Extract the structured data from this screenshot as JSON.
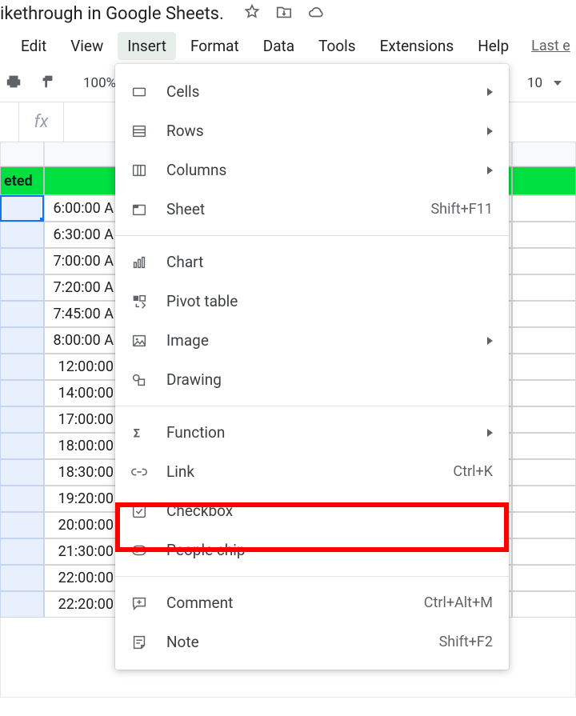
{
  "title": "ikethrough in Google Sheets.",
  "menubar": {
    "edit": "Edit",
    "view": "View",
    "insert": "Insert",
    "format": "Format",
    "data": "Data",
    "tools": "Tools",
    "extensions": "Extensions",
    "help": "Help",
    "last_edit": "Last e"
  },
  "toolbar": {
    "zoom": "100%",
    "fontsize": "10"
  },
  "formula": {
    "fx": "fx"
  },
  "sheet": {
    "header_label": "eted",
    "times": [
      "6:00:00 A",
      "6:30:00 A",
      "7:00:00 A",
      "7:20:00 A",
      "7:45:00 A",
      "8:00:00 A",
      "12:00:00",
      "14:00:00",
      "17:00:00",
      "18:00:00",
      "18:30:00",
      "19:20:00",
      "20:00:00",
      "21:30:00",
      "22:00:00",
      "22:20:00"
    ]
  },
  "menu": {
    "cells": "Cells",
    "rows": "Rows",
    "columns": "Columns",
    "sheet": "Sheet",
    "sheet_sc": "Shift+F11",
    "chart": "Chart",
    "pivot": "Pivot table",
    "image": "Image",
    "drawing": "Drawing",
    "function": "Function",
    "link": "Link",
    "link_sc": "Ctrl+K",
    "checkbox": "Checkbox",
    "people": "People chip",
    "comment": "Comment",
    "comment_sc": "Ctrl+Alt+M",
    "note": "Note",
    "note_sc": "Shift+F2"
  }
}
